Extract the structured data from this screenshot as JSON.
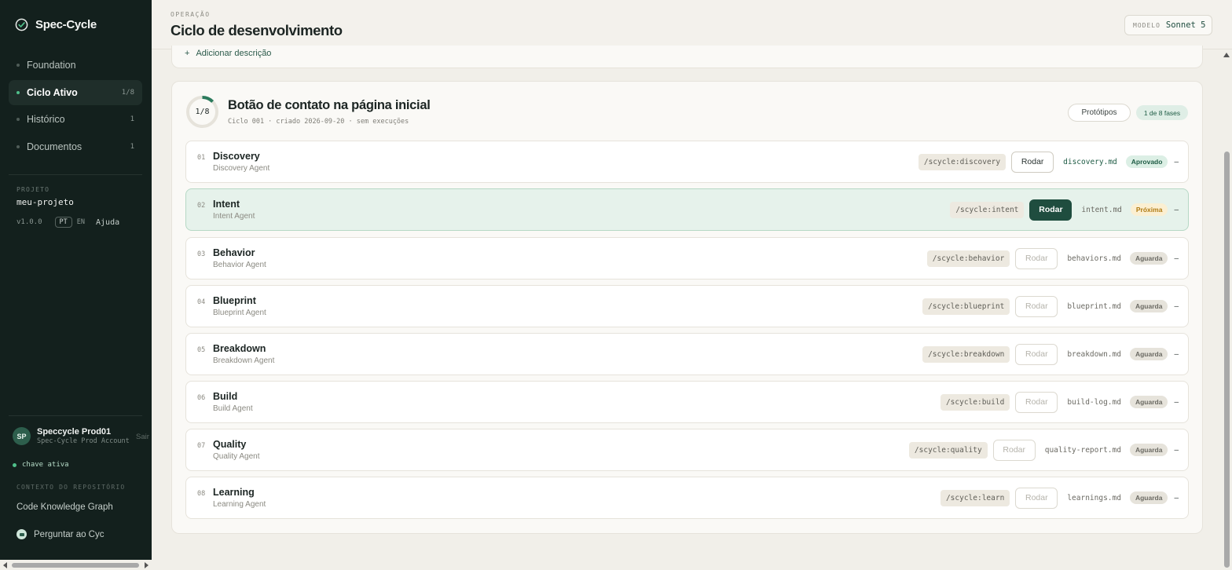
{
  "brand": {
    "name": "Spec-Cycle",
    "icon": "check-circle-icon"
  },
  "nav": [
    {
      "label": "Foundation",
      "count": ""
    },
    {
      "label": "Ciclo Ativo",
      "count": "1/8",
      "active": true
    },
    {
      "label": "Histórico",
      "count": "1"
    },
    {
      "label": "Documentos",
      "count": "1"
    }
  ],
  "project": {
    "label": "PROJETO",
    "name": "meu-projeto",
    "version": "v1.0.0",
    "lang_pt": "PT",
    "lang_en": "EN",
    "help": "Ajuda"
  },
  "user": {
    "initials": "SP",
    "name": "Speccycle Prod01",
    "account": "Spec-Cycle Prod Account",
    "signout": "Sair"
  },
  "key_status": "chave ativa",
  "repo_context": {
    "label": "CONTEXTO DO REPOSITÓRIO",
    "knowledge_graph": "Code Knowledge Graph",
    "ask": "Perguntar ao Cyc"
  },
  "header": {
    "eyebrow": "OPERAÇÃO",
    "title": "Ciclo de desenvolvimento",
    "model_label": "MODELO",
    "model_value": "Sonnet 5"
  },
  "add_description": "Adicionar descrição",
  "cycle": {
    "progress_label": "1/8",
    "progress_fraction": 0.125,
    "title": "Botão de contato na página inicial",
    "meta": "Ciclo 001 · criado 2026-09-20 · sem execuções",
    "prototypes_button": "Protótipos",
    "phase_count": "1 de 8 fases"
  },
  "colors": {
    "accent": "#1f4d3f",
    "approved": "#1f5c45",
    "next": "#b07a12",
    "sidebar_bg": "#13201d"
  },
  "phases": [
    {
      "num": "01",
      "name": "Discovery",
      "agent": "Discovery Agent",
      "command": "/scycle:discovery",
      "run_label": "Rodar",
      "file": "discovery.md",
      "status": "Aprovado",
      "trail": "–"
    },
    {
      "num": "02",
      "name": "Intent",
      "agent": "Intent Agent",
      "command": "/scycle:intent",
      "run_label": "Rodar",
      "file": "intent.md",
      "status": "Próxima",
      "trail": "–"
    },
    {
      "num": "03",
      "name": "Behavior",
      "agent": "Behavior Agent",
      "command": "/scycle:behavior",
      "run_label": "Rodar",
      "file": "behaviors.md",
      "status": "Aguarda",
      "trail": "–"
    },
    {
      "num": "04",
      "name": "Blueprint",
      "agent": "Blueprint Agent",
      "command": "/scycle:blueprint",
      "run_label": "Rodar",
      "file": "blueprint.md",
      "status": "Aguarda",
      "trail": "–"
    },
    {
      "num": "05",
      "name": "Breakdown",
      "agent": "Breakdown Agent",
      "command": "/scycle:breakdown",
      "run_label": "Rodar",
      "file": "breakdown.md",
      "status": "Aguarda",
      "trail": "–"
    },
    {
      "num": "06",
      "name": "Build",
      "agent": "Build Agent",
      "command": "/scycle:build",
      "run_label": "Rodar",
      "file": "build-log.md",
      "status": "Aguarda",
      "trail": "–"
    },
    {
      "num": "07",
      "name": "Quality",
      "agent": "Quality Agent",
      "command": "/scycle:quality",
      "run_label": "Rodar",
      "file": "quality-report.md",
      "status": "Aguarda",
      "trail": "–"
    },
    {
      "num": "08",
      "name": "Learning",
      "agent": "Learning Agent",
      "command": "/scycle:learn",
      "run_label": "Rodar",
      "file": "learnings.md",
      "status": "Aguarda",
      "trail": "–"
    }
  ]
}
